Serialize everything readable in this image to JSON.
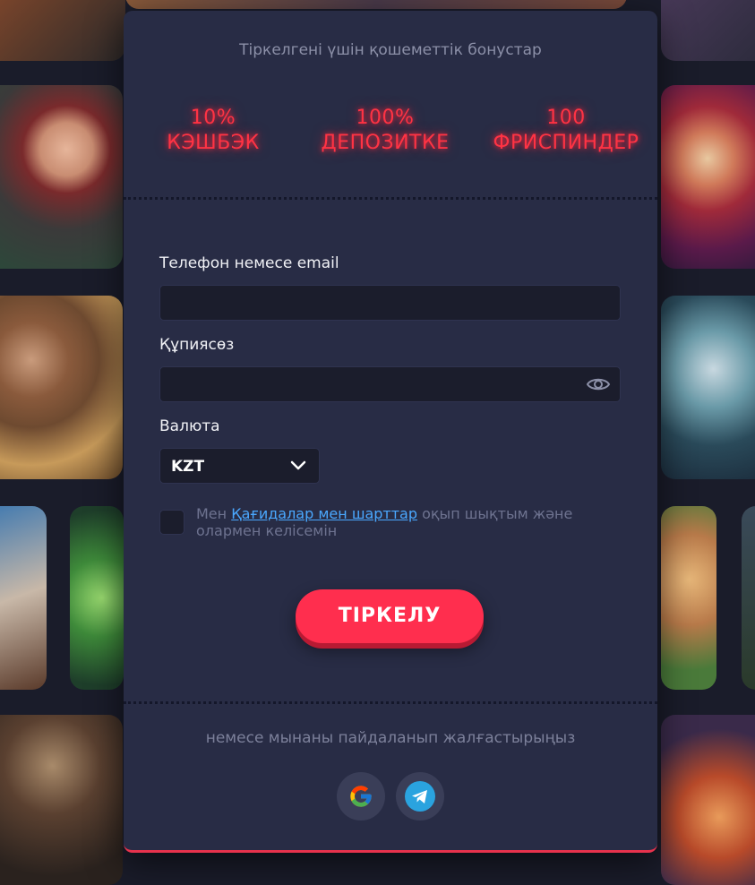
{
  "header": {
    "title": "Тіркелгені үшін қошеметтік бонустар"
  },
  "bonuses": [
    {
      "line1": "10%",
      "line2": "КЭШБЭК"
    },
    {
      "line1": "100%",
      "line2": "ДЕПОЗИТКЕ"
    },
    {
      "line1": "100",
      "line2": "ФРИСПИНДЕР"
    }
  ],
  "form": {
    "phone_label": "Телефон немесе email",
    "phone_value": "",
    "password_label": "Құпиясөз",
    "password_value": "",
    "currency_label": "Валюта",
    "currency_value": "KZT",
    "agree_prefix": "Мен ",
    "agree_link": "Қағидалар мен шарттар",
    "agree_suffix": " оқып шықтым және олармен келісемін",
    "submit_label": "ТІРКЕЛУ"
  },
  "social": {
    "or_text": "немесе мынаны пайдаланып жалғастырыңыз",
    "providers": [
      {
        "icon": "google-icon"
      },
      {
        "icon": "telegram-icon"
      }
    ]
  },
  "colors": {
    "card_bg": "#282c45",
    "accent": "#ff2e4e",
    "neon": "#ff3344",
    "link": "#4aa8ff"
  }
}
